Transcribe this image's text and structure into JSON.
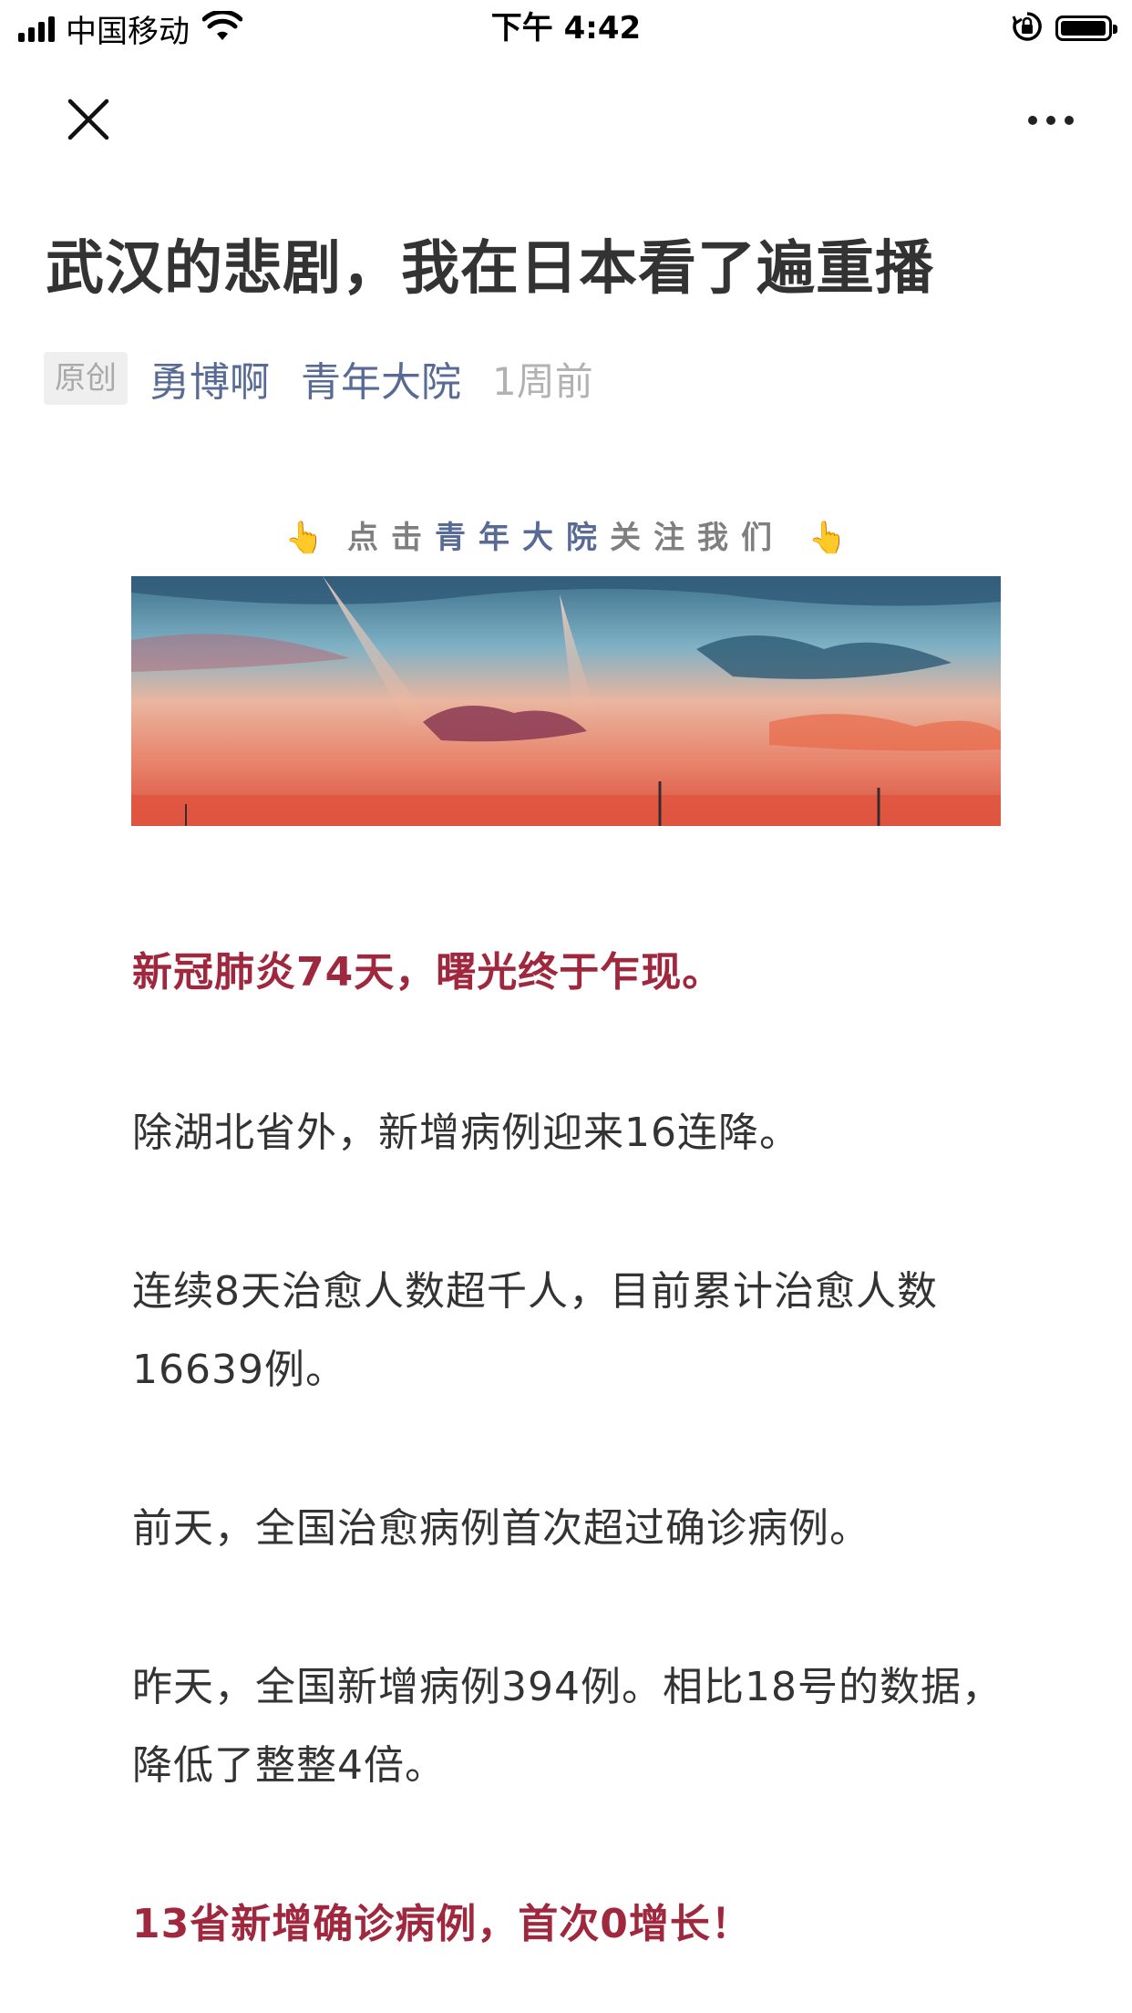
{
  "status_bar": {
    "carrier": "中国移动",
    "time": "下午 4:42"
  },
  "nav": {
    "close_icon": "close-icon",
    "more_icon": "more-icon"
  },
  "article": {
    "title": "武汉的悲剧，我在日本看了遍重播",
    "tag": "原创",
    "author": "勇博啊",
    "account": "青年大院",
    "published": "1周前",
    "follow_prefix": "点击",
    "follow_brand": "青年大院",
    "follow_suffix": "关注我们",
    "paragraphs": [
      "新冠肺炎74天，曙光终于乍现。",
      "除湖北省外，新增病例迎来16连降。",
      "连续8天治愈人数超千人，目前累计治愈人数16639例。",
      "前天，全国治愈病例首次超过确诊病例。",
      "昨天，全国新增病例394例。相比18号的数据，降低了整整4倍。",
      "13省新增确诊病例，首次0增长！"
    ]
  },
  "colors": {
    "highlight": "#a0283e",
    "link": "#576b95",
    "muted": "#b2b2b2"
  }
}
